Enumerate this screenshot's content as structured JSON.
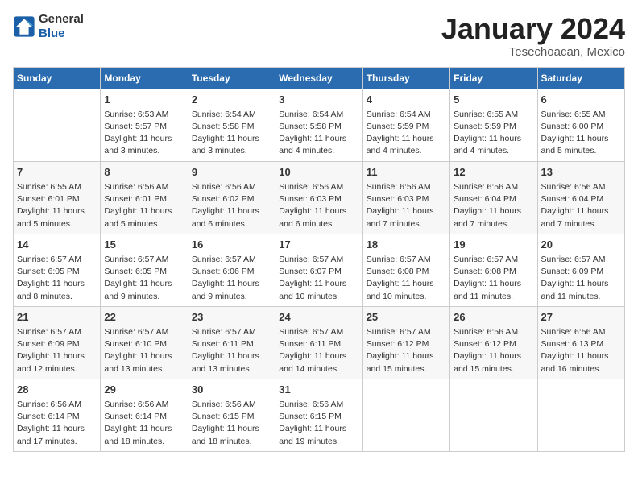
{
  "header": {
    "logo_line1": "General",
    "logo_line2": "Blue",
    "month": "January 2024",
    "location": "Tesechoacan, Mexico"
  },
  "weekdays": [
    "Sunday",
    "Monday",
    "Tuesday",
    "Wednesday",
    "Thursday",
    "Friday",
    "Saturday"
  ],
  "weeks": [
    [
      {
        "day": "",
        "sunrise": "",
        "sunset": "",
        "daylight": ""
      },
      {
        "day": "1",
        "sunrise": "Sunrise: 6:53 AM",
        "sunset": "Sunset: 5:57 PM",
        "daylight": "Daylight: 11 hours and 3 minutes."
      },
      {
        "day": "2",
        "sunrise": "Sunrise: 6:54 AM",
        "sunset": "Sunset: 5:58 PM",
        "daylight": "Daylight: 11 hours and 3 minutes."
      },
      {
        "day": "3",
        "sunrise": "Sunrise: 6:54 AM",
        "sunset": "Sunset: 5:58 PM",
        "daylight": "Daylight: 11 hours and 4 minutes."
      },
      {
        "day": "4",
        "sunrise": "Sunrise: 6:54 AM",
        "sunset": "Sunset: 5:59 PM",
        "daylight": "Daylight: 11 hours and 4 minutes."
      },
      {
        "day": "5",
        "sunrise": "Sunrise: 6:55 AM",
        "sunset": "Sunset: 5:59 PM",
        "daylight": "Daylight: 11 hours and 4 minutes."
      },
      {
        "day": "6",
        "sunrise": "Sunrise: 6:55 AM",
        "sunset": "Sunset: 6:00 PM",
        "daylight": "Daylight: 11 hours and 5 minutes."
      }
    ],
    [
      {
        "day": "7",
        "sunrise": "Sunrise: 6:55 AM",
        "sunset": "Sunset: 6:01 PM",
        "daylight": "Daylight: 11 hours and 5 minutes."
      },
      {
        "day": "8",
        "sunrise": "Sunrise: 6:56 AM",
        "sunset": "Sunset: 6:01 PM",
        "daylight": "Daylight: 11 hours and 5 minutes."
      },
      {
        "day": "9",
        "sunrise": "Sunrise: 6:56 AM",
        "sunset": "Sunset: 6:02 PM",
        "daylight": "Daylight: 11 hours and 6 minutes."
      },
      {
        "day": "10",
        "sunrise": "Sunrise: 6:56 AM",
        "sunset": "Sunset: 6:03 PM",
        "daylight": "Daylight: 11 hours and 6 minutes."
      },
      {
        "day": "11",
        "sunrise": "Sunrise: 6:56 AM",
        "sunset": "Sunset: 6:03 PM",
        "daylight": "Daylight: 11 hours and 7 minutes."
      },
      {
        "day": "12",
        "sunrise": "Sunrise: 6:56 AM",
        "sunset": "Sunset: 6:04 PM",
        "daylight": "Daylight: 11 hours and 7 minutes."
      },
      {
        "day": "13",
        "sunrise": "Sunrise: 6:56 AM",
        "sunset": "Sunset: 6:04 PM",
        "daylight": "Daylight: 11 hours and 7 minutes."
      }
    ],
    [
      {
        "day": "14",
        "sunrise": "Sunrise: 6:57 AM",
        "sunset": "Sunset: 6:05 PM",
        "daylight": "Daylight: 11 hours and 8 minutes."
      },
      {
        "day": "15",
        "sunrise": "Sunrise: 6:57 AM",
        "sunset": "Sunset: 6:05 PM",
        "daylight": "Daylight: 11 hours and 9 minutes."
      },
      {
        "day": "16",
        "sunrise": "Sunrise: 6:57 AM",
        "sunset": "Sunset: 6:06 PM",
        "daylight": "Daylight: 11 hours and 9 minutes."
      },
      {
        "day": "17",
        "sunrise": "Sunrise: 6:57 AM",
        "sunset": "Sunset: 6:07 PM",
        "daylight": "Daylight: 11 hours and 10 minutes."
      },
      {
        "day": "18",
        "sunrise": "Sunrise: 6:57 AM",
        "sunset": "Sunset: 6:08 PM",
        "daylight": "Daylight: 11 hours and 10 minutes."
      },
      {
        "day": "19",
        "sunrise": "Sunrise: 6:57 AM",
        "sunset": "Sunset: 6:08 PM",
        "daylight": "Daylight: 11 hours and 11 minutes."
      },
      {
        "day": "20",
        "sunrise": "Sunrise: 6:57 AM",
        "sunset": "Sunset: 6:09 PM",
        "daylight": "Daylight: 11 hours and 11 minutes."
      }
    ],
    [
      {
        "day": "21",
        "sunrise": "Sunrise: 6:57 AM",
        "sunset": "Sunset: 6:09 PM",
        "daylight": "Daylight: 11 hours and 12 minutes."
      },
      {
        "day": "22",
        "sunrise": "Sunrise: 6:57 AM",
        "sunset": "Sunset: 6:10 PM",
        "daylight": "Daylight: 11 hours and 13 minutes."
      },
      {
        "day": "23",
        "sunrise": "Sunrise: 6:57 AM",
        "sunset": "Sunset: 6:11 PM",
        "daylight": "Daylight: 11 hours and 13 minutes."
      },
      {
        "day": "24",
        "sunrise": "Sunrise: 6:57 AM",
        "sunset": "Sunset: 6:11 PM",
        "daylight": "Daylight: 11 hours and 14 minutes."
      },
      {
        "day": "25",
        "sunrise": "Sunrise: 6:57 AM",
        "sunset": "Sunset: 6:12 PM",
        "daylight": "Daylight: 11 hours and 15 minutes."
      },
      {
        "day": "26",
        "sunrise": "Sunrise: 6:56 AM",
        "sunset": "Sunset: 6:12 PM",
        "daylight": "Daylight: 11 hours and 15 minutes."
      },
      {
        "day": "27",
        "sunrise": "Sunrise: 6:56 AM",
        "sunset": "Sunset: 6:13 PM",
        "daylight": "Daylight: 11 hours and 16 minutes."
      }
    ],
    [
      {
        "day": "28",
        "sunrise": "Sunrise: 6:56 AM",
        "sunset": "Sunset: 6:14 PM",
        "daylight": "Daylight: 11 hours and 17 minutes."
      },
      {
        "day": "29",
        "sunrise": "Sunrise: 6:56 AM",
        "sunset": "Sunset: 6:14 PM",
        "daylight": "Daylight: 11 hours and 18 minutes."
      },
      {
        "day": "30",
        "sunrise": "Sunrise: 6:56 AM",
        "sunset": "Sunset: 6:15 PM",
        "daylight": "Daylight: 11 hours and 18 minutes."
      },
      {
        "day": "31",
        "sunrise": "Sunrise: 6:56 AM",
        "sunset": "Sunset: 6:15 PM",
        "daylight": "Daylight: 11 hours and 19 minutes."
      },
      {
        "day": "",
        "sunrise": "",
        "sunset": "",
        "daylight": ""
      },
      {
        "day": "",
        "sunrise": "",
        "sunset": "",
        "daylight": ""
      },
      {
        "day": "",
        "sunrise": "",
        "sunset": "",
        "daylight": ""
      }
    ]
  ]
}
